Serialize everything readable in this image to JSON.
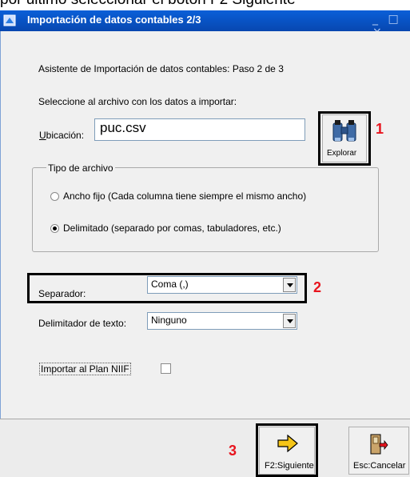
{
  "doc_caption": "por último seleccionar el botón F2 Siguiente",
  "window": {
    "title": "Importación de datos contables 2/3",
    "controls": "_ □ ×"
  },
  "wizard": {
    "step_text": "Asistente de Importación de datos contables: Paso 2 de 3",
    "select_file_text": "Seleccione al archivo con los datos a importar:",
    "location_label": "Ubicación:",
    "location_value": "puc.csv",
    "explore_label": "Explorar"
  },
  "file_type": {
    "legend": "Tipo de archivo",
    "options": [
      {
        "label": "Ancho fijo (Cada columna tiene siempre el mismo ancho)",
        "selected": false
      },
      {
        "label": "Delimitado (separado por comas, tabuladores, etc.)",
        "selected": true
      }
    ]
  },
  "separator": {
    "label": "Separador:",
    "value": "Coma (,)"
  },
  "text_delimiter": {
    "label": "Delimitador de texto:",
    "value": "Ninguno"
  },
  "niif": {
    "label": "Importar al Plan  NIIF",
    "checked": false
  },
  "buttons": {
    "next_label": "F2:Siguiente",
    "cancel_label": "Esc:Cancelar"
  },
  "callouts": [
    "1",
    "2",
    "3"
  ],
  "colors": {
    "titlebar": "#0a5fd8",
    "callout_number": "#e8141e",
    "next_arrow": "#f5c518"
  }
}
